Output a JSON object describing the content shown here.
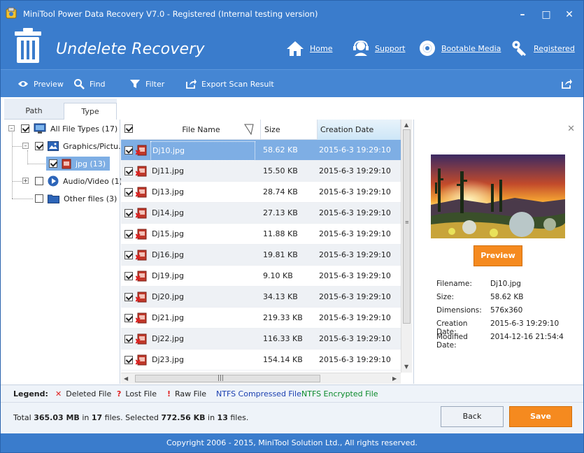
{
  "window": {
    "title": "MiniTool Power Data Recovery V7.0 - Registered (Internal testing version)"
  },
  "header": {
    "title": "Undelete Recovery",
    "links": [
      {
        "label": "Home",
        "icon": "home-icon"
      },
      {
        "label": "Support",
        "icon": "support-icon"
      },
      {
        "label": "Bootable Media",
        "icon": "disc-icon"
      },
      {
        "label": "Registered",
        "icon": "key-icon"
      }
    ]
  },
  "toolbar": {
    "preview": "Preview",
    "find": "Find",
    "filter": "Filter",
    "export": "Export Scan Result"
  },
  "tabs": {
    "path": "Path",
    "type": "Type",
    "active": "Type"
  },
  "tree": {
    "all": "All File Types (17)",
    "graphics": "Graphics/Pictu...",
    "jpg": "jpg (13)",
    "audio": "Audio/Video (1)",
    "other": "Other files (3)"
  },
  "filelist": {
    "columns": {
      "name": "File Name",
      "size": "Size",
      "date": "Creation Date"
    },
    "rows": [
      {
        "name": "Dj10.jpg",
        "size": "58.62 KB",
        "date": "2015-6-3 19:29:10",
        "checked": true,
        "selected": true
      },
      {
        "name": "Dj11.jpg",
        "size": "15.50 KB",
        "date": "2015-6-3 19:29:10",
        "checked": true
      },
      {
        "name": "Dj13.jpg",
        "size": "28.74 KB",
        "date": "2015-6-3 19:29:10",
        "checked": true
      },
      {
        "name": "Dj14.jpg",
        "size": "27.13 KB",
        "date": "2015-6-3 19:29:10",
        "checked": true
      },
      {
        "name": "Dj15.jpg",
        "size": "11.88 KB",
        "date": "2015-6-3 19:29:10",
        "checked": true
      },
      {
        "name": "Dj16.jpg",
        "size": "19.81 KB",
        "date": "2015-6-3 19:29:10",
        "checked": true
      },
      {
        "name": "Dj19.jpg",
        "size": "9.10 KB",
        "date": "2015-6-3 19:29:10",
        "checked": true
      },
      {
        "name": "Dj20.jpg",
        "size": "34.13 KB",
        "date": "2015-6-3 19:29:10",
        "checked": true
      },
      {
        "name": "Dj21.jpg",
        "size": "219.33 KB",
        "date": "2015-6-3 19:29:10",
        "checked": true
      },
      {
        "name": "Dj22.jpg",
        "size": "116.33 KB",
        "date": "2015-6-3 19:29:10",
        "checked": true
      },
      {
        "name": "Dj23.jpg",
        "size": "154.14 KB",
        "date": "2015-6-3 19:29:10",
        "checked": true
      }
    ]
  },
  "preview": {
    "button": "Preview",
    "info": [
      {
        "key": "Filename:",
        "value": "Dj10.jpg"
      },
      {
        "key": "Size:",
        "value": "58.62 KB"
      },
      {
        "key": "Dimensions:",
        "value": "576x360"
      },
      {
        "key": "Creation Date:",
        "value": "2015-6-3 19:29:10"
      },
      {
        "key": "Modified Date:",
        "value": "2014-12-16 21:54:4"
      }
    ]
  },
  "legend": {
    "label": "Legend:",
    "deleted": "Deleted File",
    "lost": "Lost File",
    "raw": "Raw File",
    "compressed": "NTFS Compressed File",
    "encrypted": "NTFS Encrypted File",
    "colors": {
      "deleted": "#e02020",
      "compressed": "#1a3fb0",
      "encrypted": "#0a8a2a"
    }
  },
  "status": {
    "total_prefix": "Total",
    "total_size": "365.03 MB",
    "in1": "in",
    "total_files": "17",
    "files1": "files.  Selected",
    "sel_size": "772.56 KB",
    "in2": "in",
    "sel_files": "13",
    "files2": "files."
  },
  "buttons": {
    "back": "Back",
    "save": "Save"
  },
  "footer": {
    "copyright": "Copyright 2006 - 2015, MiniTool Solution Ltd., All rights reserved."
  }
}
